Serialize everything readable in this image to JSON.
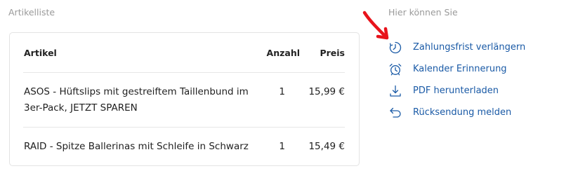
{
  "articles": {
    "section_title": "Artikelliste",
    "headers": {
      "article": "Artikel",
      "quantity": "Anzahl",
      "price": "Preis"
    },
    "rows": [
      {
        "name": "ASOS - Hüftslips mit gestreiftem Taillenbund im 3er-Pack, JETZT SPAREN",
        "quantity": "1",
        "price": "15,99 €"
      },
      {
        "name": "RAID - Spitze Ballerinas mit Schleife in Schwarz",
        "quantity": "1",
        "price": "15,49 €"
      }
    ]
  },
  "actions": {
    "section_title": "Hier können Sie",
    "items": [
      {
        "label": "Zahlungsfrist verlängern",
        "icon": "clock-icon"
      },
      {
        "label": "Kalender Erinnerung",
        "icon": "alarm-clock-icon"
      },
      {
        "label": "PDF herunterladen",
        "icon": "download-icon"
      },
      {
        "label": "Rücksendung melden",
        "icon": "return-arrow-icon"
      }
    ],
    "link_color": "#1a5aa6"
  },
  "annotation": {
    "color": "#e8131b",
    "icon": "red-arrow-annotation"
  }
}
